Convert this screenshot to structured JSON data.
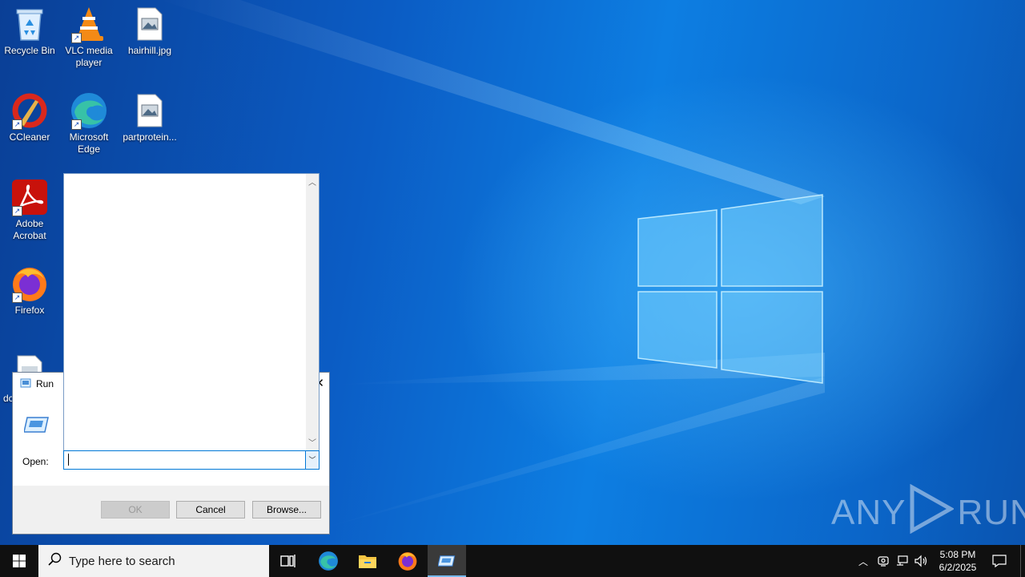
{
  "desktop": {
    "icons": [
      {
        "label": "Recycle Bin",
        "icon": "recycle-bin-icon"
      },
      {
        "label": "VLC media player",
        "icon": "vlc-icon"
      },
      {
        "label": "hairhill.jpg",
        "icon": "image-file-icon"
      },
      {
        "label": "CCleaner",
        "icon": "ccleaner-icon"
      },
      {
        "label": "Microsoft Edge",
        "icon": "edge-icon"
      },
      {
        "label": "partprotein...",
        "icon": "image-file-icon"
      },
      {
        "label": "Adobe Acrobat",
        "icon": "acrobat-icon"
      },
      {
        "label": "Firefox",
        "icon": "firefox-icon"
      },
      {
        "label": "dc",
        "icon": "document-file-icon"
      }
    ]
  },
  "run_dialog": {
    "title": "Run",
    "open_label": "Open:",
    "open_value": "",
    "ok_label": "OK",
    "cancel_label": "Cancel",
    "browse_label": "Browse..."
  },
  "taskbar": {
    "search_placeholder": "Type here to search",
    "time": "5:08 PM",
    "date": "6/2/2025",
    "pinned": [
      "task-view-icon",
      "edge-icon",
      "file-explorer-icon",
      "firefox-icon",
      "run-icon"
    ]
  },
  "watermark": {
    "left": "ANY",
    "right": "RUN"
  },
  "colors": {
    "accent": "#0078d7",
    "taskbar": "#101010",
    "active_tab": "#3a7bd5"
  }
}
